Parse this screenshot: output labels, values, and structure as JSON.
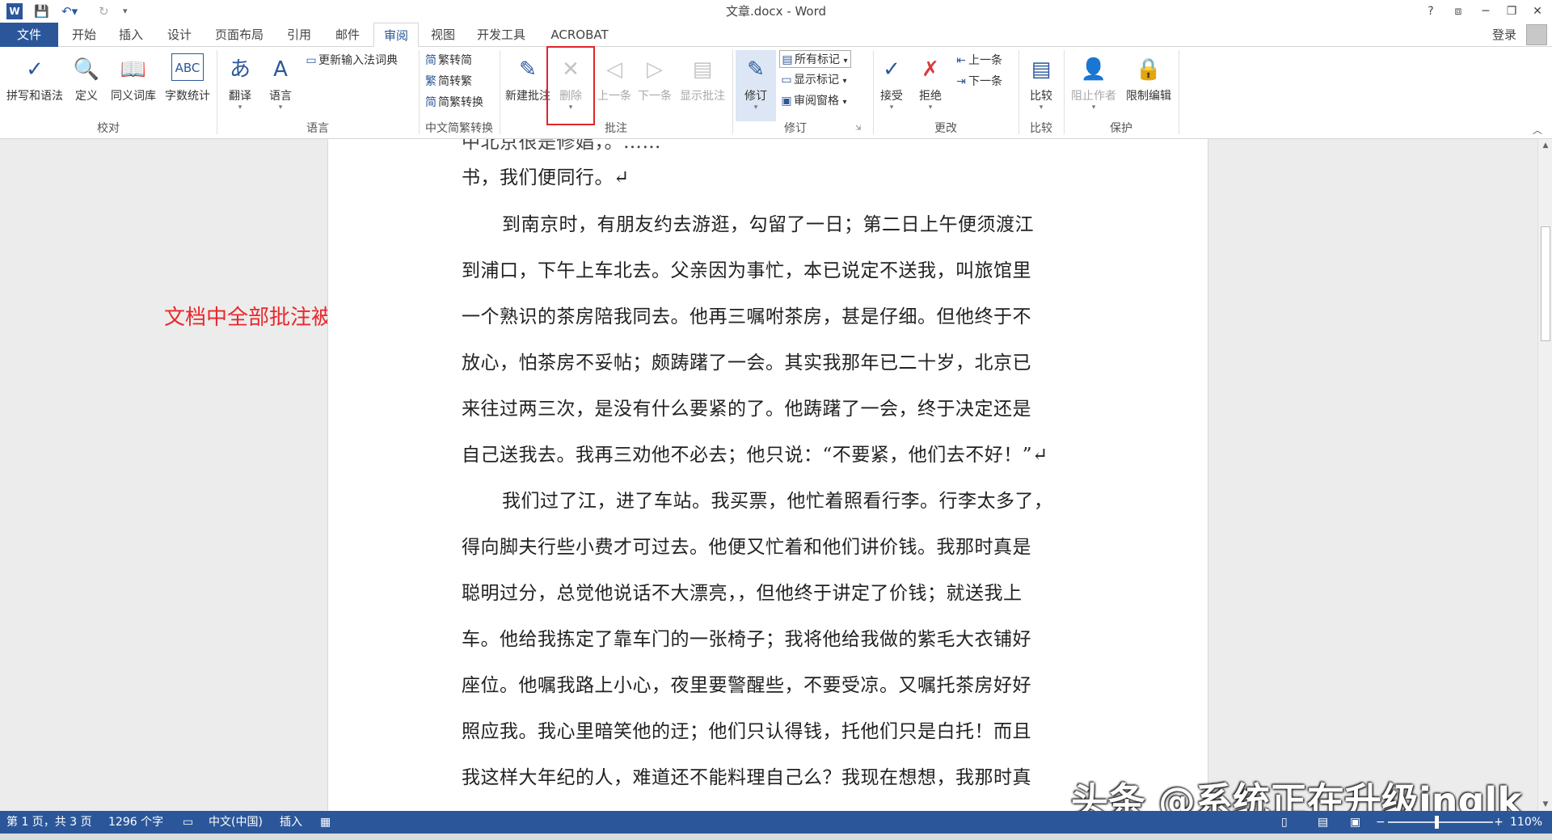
{
  "titlebar": {
    "title": "文章.docx - Word",
    "help": "?",
    "ribbon_display": "⧈",
    "minimize": "─",
    "restore": "❐",
    "close": "✕"
  },
  "tabs": {
    "file": "文件",
    "items": [
      "开始",
      "插入",
      "设计",
      "页面布局",
      "引用",
      "邮件",
      "审阅",
      "视图",
      "开发工具",
      "ACROBAT"
    ],
    "active": "审阅",
    "login": "登录"
  },
  "ribbon": {
    "groups": {
      "proofing": "校对",
      "language": "语言",
      "chinese_conversion": "中文简繁转换",
      "comments": "批注",
      "tracking": "修订",
      "changes": "更改",
      "compare": "比较",
      "protect": "保护"
    },
    "buttons": {
      "spelling": "拼写和语法",
      "define": "定义",
      "thesaurus": "同义词库",
      "word_count": "字数统计",
      "translate": "翻译",
      "language": "语言",
      "update_ime": "更新输入法词典",
      "trad_to_simp": "繁转简",
      "simp_to_trad": "简转繁",
      "conversion": "简繁转换",
      "new_comment": "新建批注",
      "delete": "删除",
      "prev_comment": "上一条",
      "next_comment": "下一条",
      "show_comments": "显示批注",
      "track_changes": "修订",
      "all_markup": "所有标记",
      "show_markup": "显示标记",
      "reviewing_pane": "审阅窗格",
      "accept": "接受",
      "reject": "拒绝",
      "prev_change": "上一条",
      "next_change": "下一条",
      "compare": "比较",
      "block_authors": "阻止作者",
      "restrict_editing": "限制编辑"
    },
    "icons": {
      "spelling": "✓",
      "define": "🔍",
      "thesaurus": "📖",
      "word_count": "ABC",
      "translate": "あ",
      "language": "A",
      "new_comment": "✎",
      "delete": "✕",
      "track": "✎",
      "accept": "✓",
      "reject": "✗",
      "compare": "▤",
      "block": "👤",
      "restrict": "🔒"
    }
  },
  "annotation": "文档中全部批注被删除",
  "document": {
    "lines": [
      "中北京很是修娼，。……",
      "书，我们便同行。↵",
      "到南京时，有朋友约去游逛，勾留了一日；第二日上午便须渡江",
      "到浦口，下午上车北去。父亲因为事忙，本已说定不送我，叫旅馆里",
      "一个熟识的茶房陪我同去。他再三嘱咐茶房，甚是仔细。但他终于不",
      "放心，怕茶房不妥帖；颇踌躇了一会。其实我那年已二十岁，北京已",
      "来往过两三次，是没有什么要紧的了。他踌躇了一会，终于决定还是",
      "自己送我去。我再三劝他不必去；他只说：“不要紧，他们去不好！”↵",
      "我们过了江，进了车站。我买票，他忙着照看行李。行李太多了，",
      "得向脚夫行些小费才可过去。他便又忙着和他们讲价钱。我那时真是",
      "聪明过分，总觉他说话不大漂亮，，但他终于讲定了价钱；就送我上",
      "车。他给我拣定了靠车门的一张椅子；我将他给我做的紫毛大衣铺好",
      "座位。他嘱我路上小心，夜里要警醒些，不要受凉。又嘱托茶房好好",
      "照应我。我心里暗笑他的迂；他们只认得钱，托他们只是白托！而且",
      "我这样大年纪的人，难道还不能料理自己么？我现在想想，我那时真"
    ]
  },
  "status": {
    "page": "第 1 页，共 3 页",
    "words": "1296 个字",
    "language": "中文(中国)",
    "mode": "插入",
    "zoom": "110%"
  },
  "watermark": "头条 @系统正在升级inglk"
}
